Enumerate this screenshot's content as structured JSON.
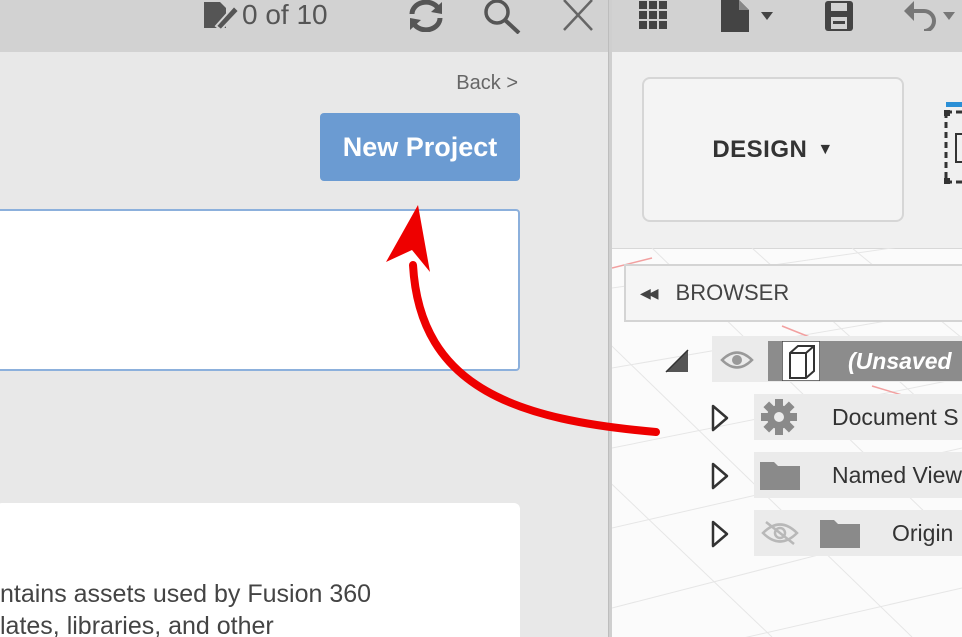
{
  "left_toolbar": {
    "counter_text": "0 of 10"
  },
  "projects_panel": {
    "back_link": "Back >",
    "new_project_label": "New Project",
    "info_line_1": "ntains assets used by Fusion 360",
    "info_line_2": "lates, libraries, and other"
  },
  "workspace": {
    "label": "DESIGN"
  },
  "browser": {
    "title": "BROWSER",
    "root_label": "(Unsaved",
    "items": [
      {
        "label": "Document S"
      },
      {
        "label": "Named View"
      },
      {
        "label": "Origin"
      }
    ]
  },
  "colors": {
    "primary_button": "#6b9bd2",
    "annotation_arrow": "#ee0000"
  }
}
